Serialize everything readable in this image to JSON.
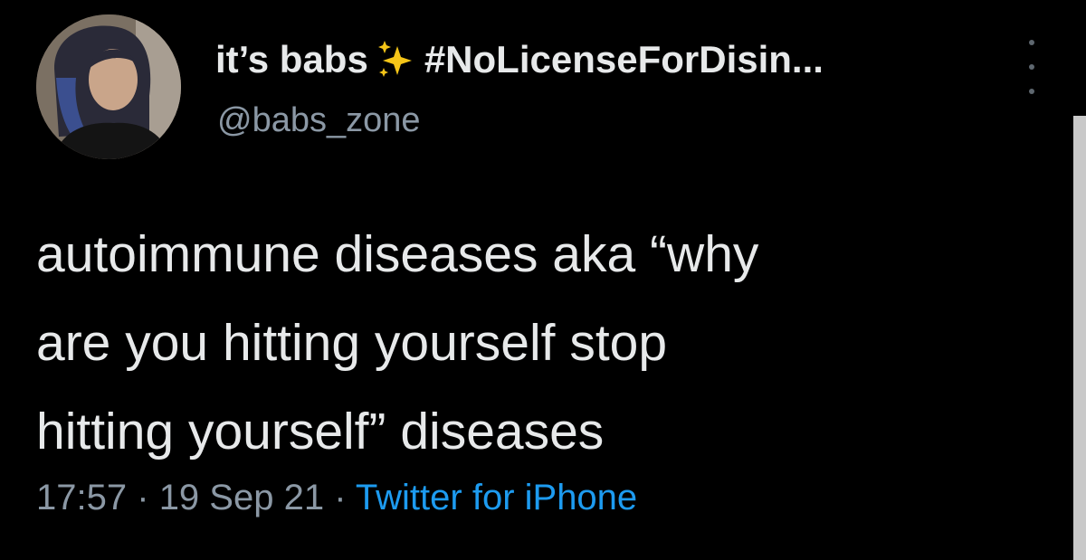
{
  "author": {
    "display_name": "it’s babs",
    "name_suffix": "#NoLicenseForDisin...",
    "handle": "@babs_zone"
  },
  "tweet": {
    "text_lines": [
      "autoimmune diseases aka “why",
      "are you hitting yourself stop",
      "hitting yourself” diseases"
    ],
    "time": "17:57",
    "separator": "·",
    "date": "19 Sep 21",
    "source": "Twitter for iPhone"
  },
  "icons": {
    "sparkle": "sparkles-icon",
    "more": "more-options-icon"
  },
  "colors": {
    "background": "#000000",
    "text": "#e7e9ea",
    "secondary": "#8b98a5",
    "link": "#1d9bf0",
    "sparkle": "#f5c518"
  }
}
